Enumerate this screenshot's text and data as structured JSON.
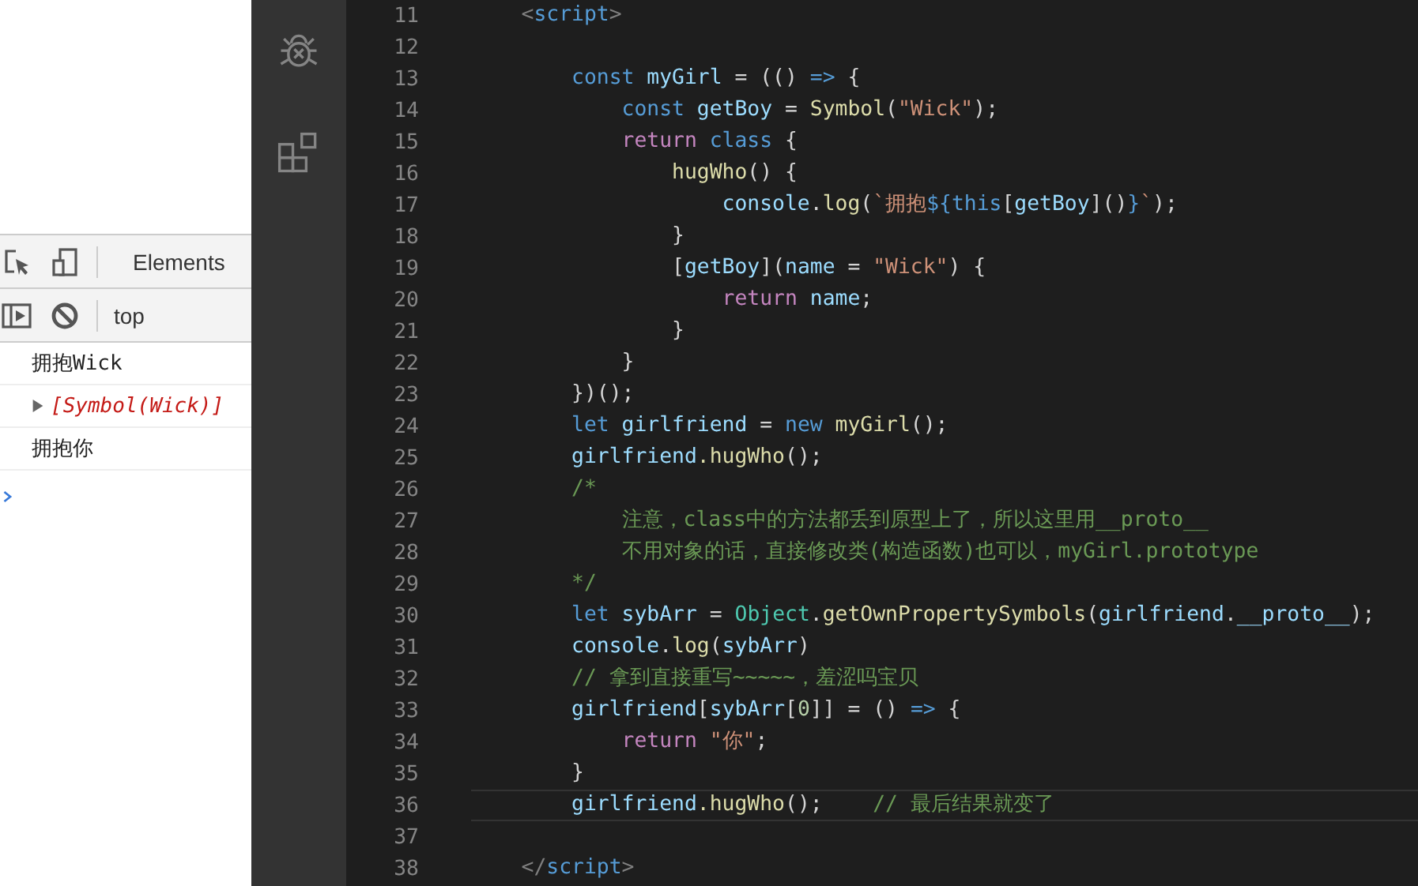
{
  "devtools": {
    "tab": "Elements",
    "context": "top",
    "messages": [
      {
        "kind": "log",
        "text": "拥抱Wick"
      },
      {
        "kind": "array",
        "text": "[Symbol(Wick)]",
        "expanded": false
      },
      {
        "kind": "log",
        "text": "拥抱你"
      }
    ]
  },
  "editor": {
    "lines": [
      {
        "number": "11",
        "current": false,
        "tokens": [
          {
            "text": "    <",
            "kind": "punctuation"
          },
          {
            "text": "script",
            "kind": "tag"
          },
          {
            "text": ">",
            "kind": "punctuation"
          }
        ]
      },
      {
        "number": "12",
        "current": false
      },
      {
        "number": "13",
        "current": false,
        "tokens": [
          {
            "text": "        const",
            "kind": "keyword"
          },
          {
            "text": " myGirl",
            "kind": "variable"
          },
          {
            "text": " = (() ",
            "kind": "plain"
          },
          {
            "text": "=>",
            "kind": "keyword"
          },
          {
            "text": " {",
            "kind": "plain"
          }
        ]
      },
      {
        "number": "14",
        "current": false,
        "tokens": [
          {
            "text": "            const",
            "kind": "keyword"
          },
          {
            "text": " getBoy",
            "kind": "variable"
          },
          {
            "text": " = ",
            "kind": "plain"
          },
          {
            "text": "Symbol",
            "kind": "function"
          },
          {
            "text": "(",
            "kind": "plain"
          },
          {
            "text": "\"Wick\"",
            "kind": "string"
          },
          {
            "text": ");",
            "kind": "plain"
          }
        ]
      },
      {
        "number": "15",
        "current": false,
        "tokens": [
          {
            "text": "            return",
            "kind": "control"
          },
          {
            "text": " class",
            "kind": "keyword"
          },
          {
            "text": " {",
            "kind": "plain"
          }
        ]
      },
      {
        "number": "16",
        "current": false,
        "tokens": [
          {
            "text": "                hugWho",
            "kind": "function"
          },
          {
            "text": "() {",
            "kind": "plain"
          }
        ]
      },
      {
        "number": "17",
        "current": false,
        "tokens": [
          {
            "text": "                    console",
            "kind": "variable"
          },
          {
            "text": ".",
            "kind": "plain"
          },
          {
            "text": "log",
            "kind": "function"
          },
          {
            "text": "(",
            "kind": "plain"
          },
          {
            "text": "`拥抱",
            "kind": "string"
          },
          {
            "text": "${",
            "kind": "keyword"
          },
          {
            "text": "this",
            "kind": "keyword"
          },
          {
            "text": "[",
            "kind": "plain"
          },
          {
            "text": "getBoy",
            "kind": "variable"
          },
          {
            "text": "]()",
            "kind": "plain"
          },
          {
            "text": "}",
            "kind": "keyword"
          },
          {
            "text": "`",
            "kind": "string"
          },
          {
            "text": ");",
            "kind": "plain"
          }
        ]
      },
      {
        "number": "18",
        "current": false,
        "tokens": [
          {
            "text": "                }",
            "kind": "plain"
          }
        ]
      },
      {
        "number": "19",
        "current": false,
        "tokens": [
          {
            "text": "                [",
            "kind": "plain"
          },
          {
            "text": "getBoy",
            "kind": "variable"
          },
          {
            "text": "](",
            "kind": "plain"
          },
          {
            "text": "name",
            "kind": "variable"
          },
          {
            "text": " = ",
            "kind": "plain"
          },
          {
            "text": "\"Wick\"",
            "kind": "string"
          },
          {
            "text": ") {",
            "kind": "plain"
          }
        ]
      },
      {
        "number": "20",
        "current": false,
        "tokens": [
          {
            "text": "                    return",
            "kind": "control"
          },
          {
            "text": " name",
            "kind": "variable"
          },
          {
            "text": ";",
            "kind": "plain"
          }
        ]
      },
      {
        "number": "21",
        "current": false,
        "tokens": [
          {
            "text": "                }",
            "kind": "plain"
          }
        ]
      },
      {
        "number": "22",
        "current": false,
        "tokens": [
          {
            "text": "            }",
            "kind": "plain"
          }
        ]
      },
      {
        "number": "23",
        "current": false,
        "tokens": [
          {
            "text": "        })();",
            "kind": "plain"
          }
        ]
      },
      {
        "number": "24",
        "current": false,
        "tokens": [
          {
            "text": "        let",
            "kind": "keyword"
          },
          {
            "text": " girlfriend",
            "kind": "variable"
          },
          {
            "text": " = ",
            "kind": "plain"
          },
          {
            "text": "new",
            "kind": "keyword"
          },
          {
            "text": " myGirl",
            "kind": "function"
          },
          {
            "text": "();",
            "kind": "plain"
          }
        ]
      },
      {
        "number": "25",
        "current": false,
        "tokens": [
          {
            "text": "        girlfriend",
            "kind": "variable"
          },
          {
            "text": ".hugWho",
            "kind": "function"
          },
          {
            "text": "();",
            "kind": "plain"
          }
        ]
      },
      {
        "number": "26",
        "current": false,
        "tokens": [
          {
            "text": "        /*",
            "kind": "comment"
          }
        ]
      },
      {
        "number": "27",
        "current": false,
        "tokens": [
          {
            "text": "            注意，class中的方法都丢到原型上了，所以这里用__proto__",
            "kind": "comment"
          }
        ]
      },
      {
        "number": "28",
        "current": false,
        "tokens": [
          {
            "text": "            不用对象的话，直接修改类(构造函数)也可以，myGirl.prototype",
            "kind": "comment"
          }
        ]
      },
      {
        "number": "29",
        "current": false,
        "tokens": [
          {
            "text": "        */",
            "kind": "comment"
          }
        ]
      },
      {
        "number": "30",
        "current": false,
        "tokens": [
          {
            "text": "        let",
            "kind": "keyword"
          },
          {
            "text": " sybArr",
            "kind": "variable"
          },
          {
            "text": " = ",
            "kind": "plain"
          },
          {
            "text": "Object",
            "kind": "class"
          },
          {
            "text": ".",
            "kind": "plain"
          },
          {
            "text": "getOwnPropertySymbols",
            "kind": "function"
          },
          {
            "text": "(",
            "kind": "plain"
          },
          {
            "text": "girlfriend",
            "kind": "variable"
          },
          {
            "text": ".",
            "kind": "plain"
          },
          {
            "text": "__proto__",
            "kind": "variable"
          },
          {
            "text": ");",
            "kind": "plain"
          }
        ]
      },
      {
        "number": "31",
        "current": false,
        "tokens": [
          {
            "text": "        console",
            "kind": "variable"
          },
          {
            "text": ".",
            "kind": "plain"
          },
          {
            "text": "log",
            "kind": "function"
          },
          {
            "text": "(",
            "kind": "plain"
          },
          {
            "text": "sybArr",
            "kind": "variable"
          },
          {
            "text": ")",
            "kind": "plain"
          }
        ]
      },
      {
        "number": "32",
        "current": false,
        "tokens": [
          {
            "text": "        // 拿到直接重写~~~~~，羞涩吗宝贝",
            "kind": "comment"
          }
        ]
      },
      {
        "number": "33",
        "current": false,
        "tokens": [
          {
            "text": "        girlfriend",
            "kind": "variable"
          },
          {
            "text": "[",
            "kind": "plain"
          },
          {
            "text": "sybArr",
            "kind": "variable"
          },
          {
            "text": "[",
            "kind": "plain"
          },
          {
            "text": "0",
            "kind": "number"
          },
          {
            "text": "]] = () ",
            "kind": "plain"
          },
          {
            "text": "=>",
            "kind": "keyword"
          },
          {
            "text": " {",
            "kind": "plain"
          }
        ]
      },
      {
        "number": "34",
        "current": false,
        "tokens": [
          {
            "text": "            return",
            "kind": "control"
          },
          {
            "text": " \"你\"",
            "kind": "string"
          },
          {
            "text": ";",
            "kind": "plain"
          }
        ]
      },
      {
        "number": "35",
        "current": false,
        "tokens": [
          {
            "text": "        }",
            "kind": "plain"
          }
        ]
      },
      {
        "number": "36",
        "current": true,
        "tokens": [
          {
            "text": "        girlfriend",
            "kind": "variable"
          },
          {
            "text": ".hugWho",
            "kind": "function"
          },
          {
            "text": "();",
            "kind": "plain"
          },
          {
            "text": "    // 最后结果就变了",
            "kind": "comment"
          }
        ]
      },
      {
        "number": "37",
        "current": false
      },
      {
        "number": "38",
        "current": false,
        "tokens": [
          {
            "text": "    </",
            "kind": "punctuation"
          },
          {
            "text": "script",
            "kind": "tag"
          },
          {
            "text": ">",
            "kind": "punctuation"
          }
        ]
      }
    ]
  }
}
